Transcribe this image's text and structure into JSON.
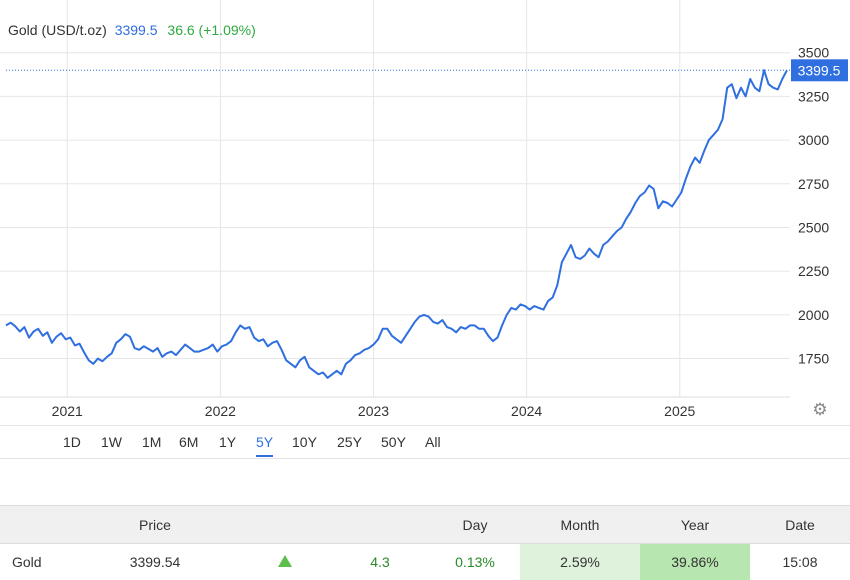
{
  "legend": {
    "name": "Gold (USD/t.oz)",
    "price": "3399.5",
    "change": "36.6 (+1.09%)"
  },
  "colors": {
    "line": "#2f6fe0",
    "up": "#2eaa3f",
    "grid": "#e6e6e6",
    "badge": "#2f6fe0"
  },
  "price_badge": "3399.5",
  "settings_icon": "gear-icon",
  "ranges": [
    "1D",
    "1W",
    "1M",
    "6M",
    "1Y",
    "5Y",
    "10Y",
    "25Y",
    "50Y",
    "All"
  ],
  "active_range": "5Y",
  "table": {
    "headers": [
      "",
      "Price",
      "",
      "",
      "Day",
      "Month",
      "Year",
      "Date"
    ],
    "row": {
      "name": "Gold",
      "price": "3399.54",
      "indicator": "up-arrow-icon",
      "change": "4.3",
      "day": "0.13%",
      "month": "2.59%",
      "year": "39.86%",
      "date": "15:08"
    }
  },
  "chart_data": {
    "type": "line",
    "title": "Gold (USD/t.oz)",
    "xlabel": "",
    "ylabel": "",
    "x_ticks": [
      "2021",
      "2022",
      "2023",
      "2024",
      "2025"
    ],
    "y_ticks": [
      "1750",
      "2000",
      "2250",
      "2500",
      "2750",
      "3000",
      "3250",
      "3500"
    ],
    "xlim": [
      2020.6,
      2025.72
    ],
    "ylim": [
      1530,
      3550
    ],
    "grid": true,
    "last_value": 3399.5,
    "series": [
      {
        "x": [
          2020.6,
          2020.63,
          2020.66,
          2020.69,
          2020.72,
          2020.75,
          2020.78,
          2020.81,
          2020.84,
          2020.87,
          2020.9,
          2020.93,
          2020.96,
          2020.99,
          2021.02,
          2021.05,
          2021.08,
          2021.11,
          2021.14,
          2021.17,
          2021.2,
          2021.23,
          2021.26,
          2021.29,
          2021.32,
          2021.35,
          2021.38,
          2021.41,
          2021.44,
          2021.47,
          2021.5,
          2021.53,
          2021.56,
          2021.59,
          2021.62,
          2021.65,
          2021.68,
          2021.71,
          2021.74,
          2021.77,
          2021.8,
          2021.83,
          2021.86,
          2021.89,
          2021.92,
          2021.95,
          2021.98,
          2022.01,
          2022.04,
          2022.07,
          2022.1,
          2022.13,
          2022.16,
          2022.19,
          2022.22,
          2022.25,
          2022.28,
          2022.31,
          2022.34,
          2022.37,
          2022.4,
          2022.43,
          2022.46,
          2022.49,
          2022.52,
          2022.55,
          2022.58,
          2022.61,
          2022.64,
          2022.67,
          2022.7,
          2022.73,
          2022.76,
          2022.79,
          2022.82,
          2022.85,
          2022.88,
          2022.91,
          2022.94,
          2022.97,
          2023.0,
          2023.03,
          2023.06,
          2023.09,
          2023.12,
          2023.15,
          2023.18,
          2023.21,
          2023.24,
          2023.27,
          2023.3,
          2023.33,
          2023.36,
          2023.39,
          2023.42,
          2023.45,
          2023.48,
          2023.51,
          2023.54,
          2023.57,
          2023.6,
          2023.63,
          2023.66,
          2023.69,
          2023.72,
          2023.75,
          2023.78,
          2023.81,
          2023.84,
          2023.87,
          2023.9,
          2023.93,
          2023.96,
          2023.99,
          2024.02,
          2024.05,
          2024.08,
          2024.11,
          2024.14,
          2024.17,
          2024.2,
          2024.23,
          2024.26,
          2024.29,
          2024.32,
          2024.35,
          2024.38,
          2024.41,
          2024.44,
          2024.47,
          2024.5,
          2024.53,
          2024.56,
          2024.59,
          2024.62,
          2024.65,
          2024.68,
          2024.71,
          2024.74,
          2024.77,
          2024.8,
          2024.83,
          2024.86,
          2024.89,
          2024.92,
          2024.95,
          2024.98,
          2025.01,
          2025.04,
          2025.07,
          2025.1,
          2025.13,
          2025.16,
          2025.19,
          2025.22,
          2025.25,
          2025.28,
          2025.31,
          2025.34,
          2025.37,
          2025.4,
          2025.43,
          2025.46,
          2025.49,
          2025.52,
          2025.55,
          2025.58,
          2025.61,
          2025.64,
          2025.67,
          2025.7
        ],
        "values": [
          1940,
          1955,
          1935,
          1905,
          1930,
          1870,
          1905,
          1920,
          1880,
          1900,
          1840,
          1875,
          1895,
          1860,
          1870,
          1825,
          1835,
          1785,
          1740,
          1720,
          1750,
          1735,
          1760,
          1780,
          1840,
          1860,
          1890,
          1875,
          1810,
          1800,
          1820,
          1805,
          1790,
          1810,
          1760,
          1780,
          1790,
          1770,
          1800,
          1830,
          1810,
          1790,
          1790,
          1800,
          1810,
          1830,
          1790,
          1820,
          1830,
          1850,
          1900,
          1940,
          1920,
          1930,
          1870,
          1850,
          1860,
          1820,
          1840,
          1850,
          1800,
          1740,
          1720,
          1700,
          1740,
          1760,
          1700,
          1680,
          1660,
          1670,
          1640,
          1660,
          1680,
          1660,
          1720,
          1740,
          1770,
          1780,
          1800,
          1810,
          1830,
          1860,
          1920,
          1920,
          1880,
          1860,
          1840,
          1880,
          1920,
          1960,
          1990,
          2000,
          1990,
          1960,
          1950,
          1970,
          1930,
          1920,
          1900,
          1930,
          1920,
          1940,
          1940,
          1920,
          1920,
          1880,
          1850,
          1870,
          1940,
          2000,
          2040,
          2030,
          2060,
          2050,
          2030,
          2050,
          2040,
          2030,
          2080,
          2100,
          2170,
          2300,
          2350,
          2400,
          2330,
          2320,
          2340,
          2380,
          2350,
          2330,
          2400,
          2420,
          2450,
          2480,
          2500,
          2550,
          2590,
          2640,
          2680,
          2700,
          2740,
          2720,
          2610,
          2650,
          2640,
          2620,
          2660,
          2700,
          2780,
          2850,
          2900,
          2870,
          2940,
          3000,
          3030,
          3060,
          3120,
          3300,
          3320,
          3240,
          3300,
          3250,
          3350,
          3300,
          3280,
          3400,
          3320,
          3300,
          3290,
          3350,
          3399.5
        ]
      }
    ]
  }
}
